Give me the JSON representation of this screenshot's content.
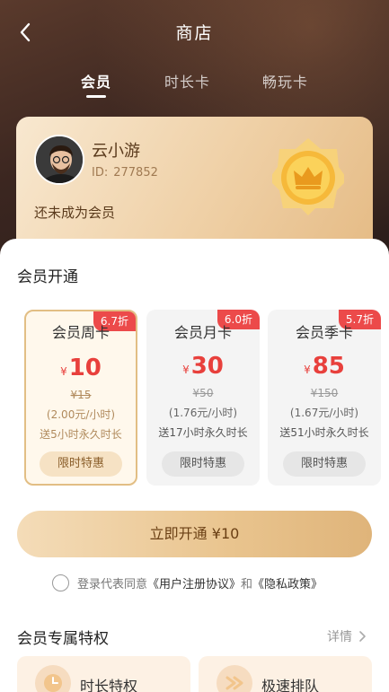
{
  "nav": {
    "title": "商店",
    "back_icon": "chevron-left-icon"
  },
  "tabs": [
    {
      "label": "会员",
      "active": true
    },
    {
      "label": "时长卡",
      "active": false
    },
    {
      "label": "畅玩卡",
      "active": false
    }
  ],
  "profile": {
    "name": "云小游",
    "id_label": "ID:",
    "id_value": "277852",
    "status": "还未成为会员",
    "badge_icon": "crown-badge-icon"
  },
  "plans_section": {
    "title": "会员开通",
    "plans": [
      {
        "name": "会员周卡",
        "discount": "6.7折",
        "currency": "¥",
        "price": "10",
        "original": "¥15",
        "per_hour": "(2.00元/小时)",
        "bonus": "送5小时永久时长",
        "tag": "限时特惠",
        "selected": true
      },
      {
        "name": "会员月卡",
        "discount": "6.0折",
        "currency": "¥",
        "price": "30",
        "original": "¥50",
        "per_hour": "(1.76元/小时)",
        "bonus": "送17小时永久时长",
        "tag": "限时特惠",
        "selected": false
      },
      {
        "name": "会员季卡",
        "discount": "5.7折",
        "currency": "¥",
        "price": "85",
        "original": "¥150",
        "per_hour": "(1.67元/小时)",
        "bonus": "送51小时永久时长",
        "tag": "限时特惠",
        "selected": false
      }
    ]
  },
  "cta": {
    "label": "立即开通 ¥10"
  },
  "agreement": {
    "prefix": "登录代表同意",
    "terms": "《用户注册协议》",
    "and": "和",
    "privacy": "《隐私政策》"
  },
  "perks": {
    "title": "会员专属特权",
    "more": "详情",
    "items": [
      {
        "label": "时长特权",
        "icon": "clock-icon"
      },
      {
        "label": "极速排队",
        "icon": "fast-queue-icon"
      }
    ]
  },
  "colors": {
    "accent": "#e8403c",
    "gold": "#e2be84",
    "header_dark": "#3b2620"
  }
}
